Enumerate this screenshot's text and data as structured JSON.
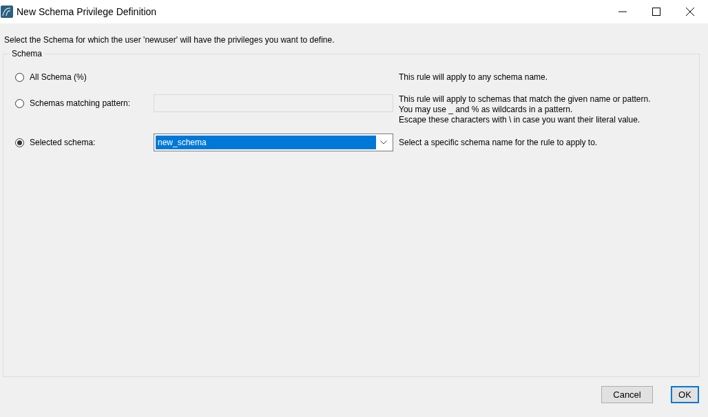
{
  "window": {
    "title": "New Schema Privilege Definition"
  },
  "instruction": "Select the Schema for which the user 'newuser' will have the privileges you want to define.",
  "group": {
    "title": "Schema",
    "options": [
      {
        "label": "All Schema (%)",
        "selected": false,
        "kind": "none",
        "description": [
          "This rule will apply to any schema name."
        ]
      },
      {
        "label": "Schemas matching pattern:",
        "selected": false,
        "kind": "text",
        "disabled": true,
        "description": [
          "This rule will apply to schemas that match the given name or pattern.",
          "You may use _ and % as wildcards in a pattern.",
          "Escape these characters with \\ in case you want their literal value."
        ]
      },
      {
        "label": "Selected schema:",
        "selected": true,
        "kind": "combo",
        "value": "new_schema",
        "highlighted": true,
        "description": [
          "Select a specific schema name for the rule to apply to."
        ]
      }
    ]
  },
  "buttons": [
    {
      "label": "Cancel",
      "default": false
    },
    {
      "label": "OK",
      "default": true
    }
  ]
}
